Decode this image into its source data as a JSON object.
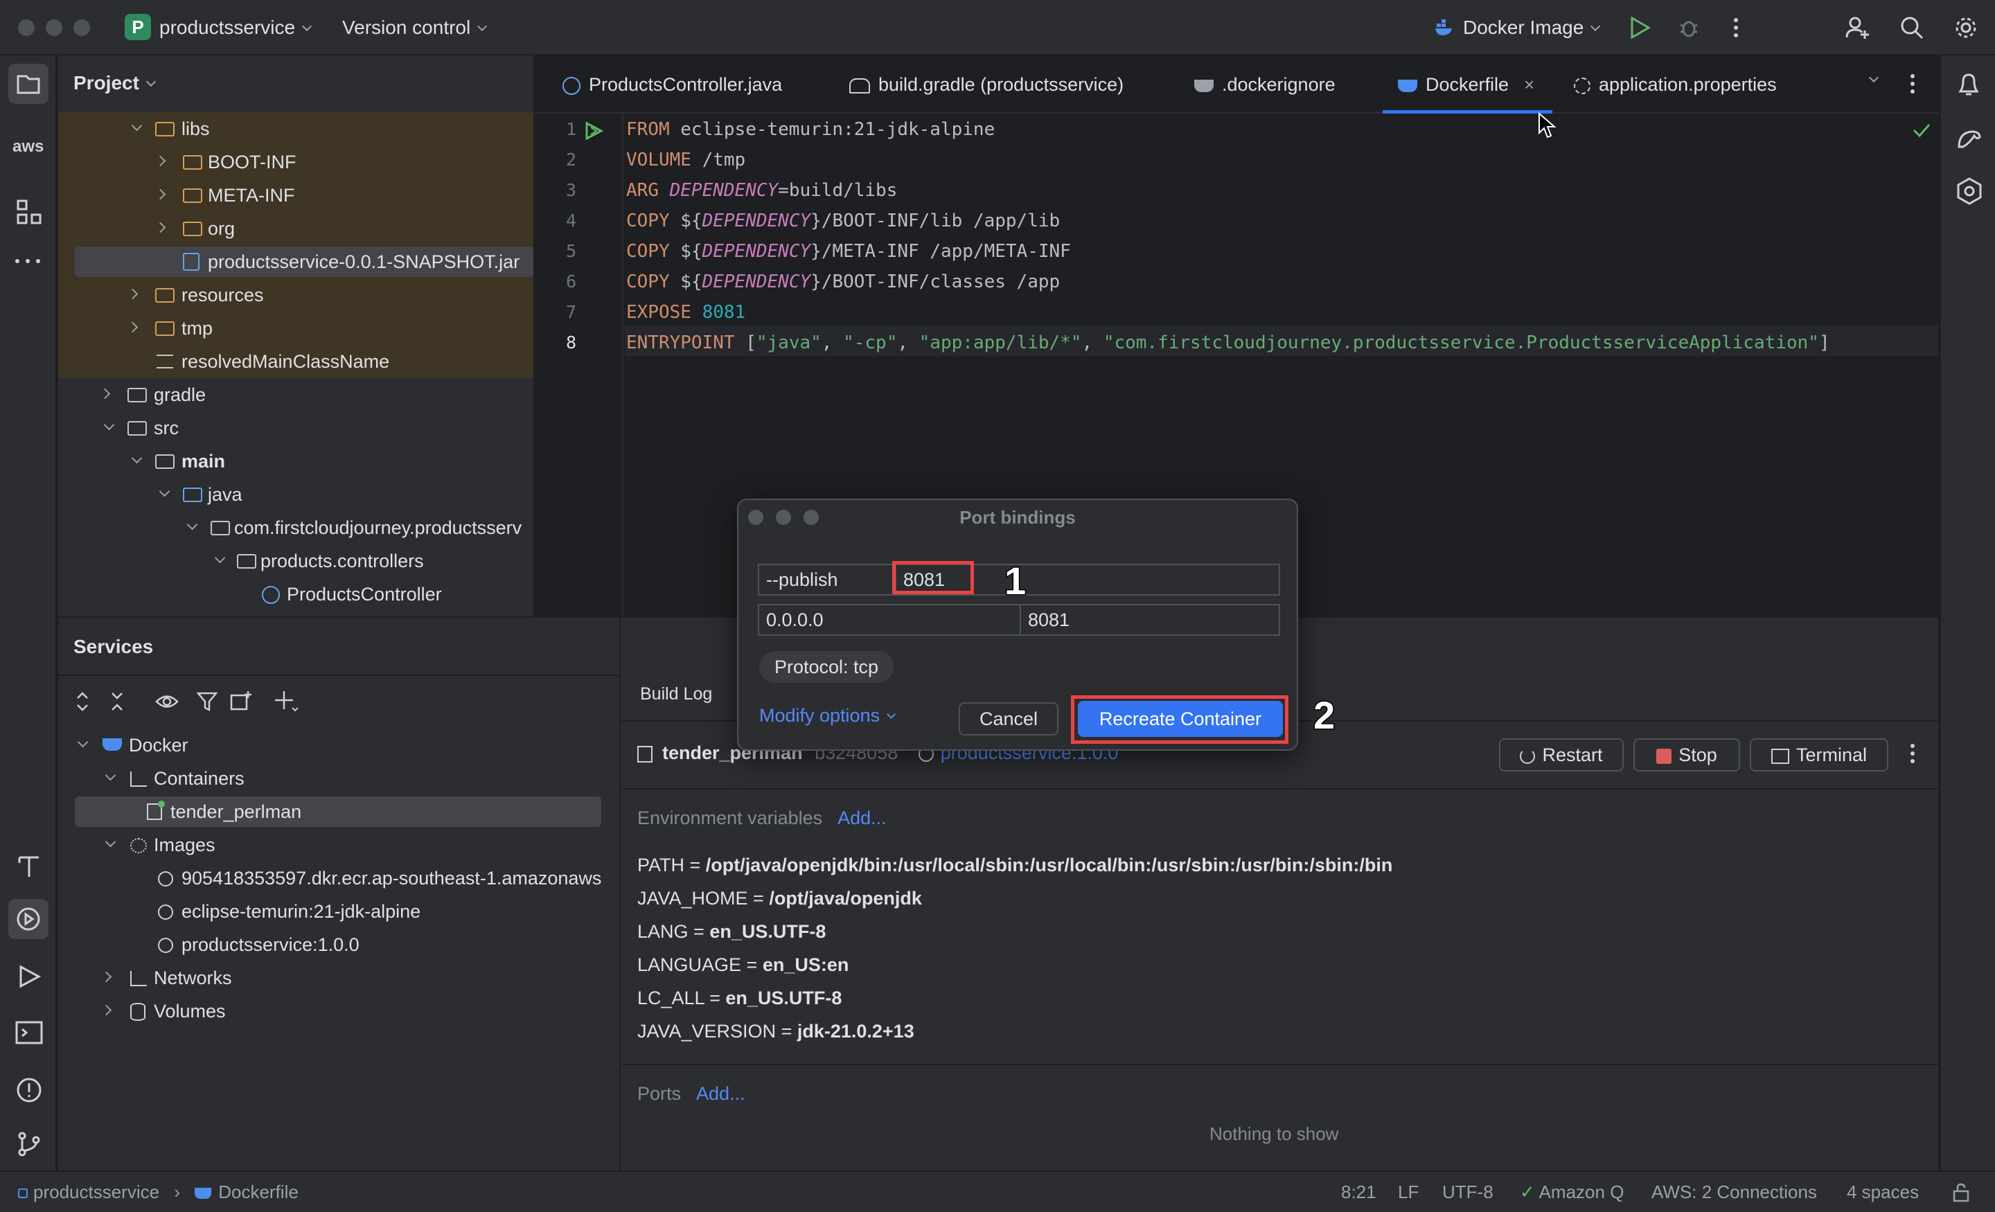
{
  "titlebar": {
    "project_badge": "P",
    "project_name": "productsservice",
    "version_control": "Version control",
    "run_config": "Docker Image"
  },
  "project_panel": {
    "title": "Project",
    "tree": [
      {
        "label": "libs",
        "icon": "folder-icon"
      },
      {
        "label": "BOOT-INF",
        "icon": "folder-icon"
      },
      {
        "label": "META-INF",
        "icon": "folder-icon"
      },
      {
        "label": "org",
        "icon": "folder-icon"
      },
      {
        "label": "productsservice-0.0.1-SNAPSHOT.jar",
        "icon": "jar-icon"
      },
      {
        "label": "resources",
        "icon": "folder-icon"
      },
      {
        "label": "tmp",
        "icon": "folder-icon"
      },
      {
        "label": "resolvedMainClassName",
        "icon": "text-file-icon"
      },
      {
        "label": "gradle",
        "icon": "folder-icon"
      },
      {
        "label": "src",
        "icon": "folder-icon"
      },
      {
        "label": "main",
        "icon": "folder-icon"
      },
      {
        "label": "java",
        "icon": "folder-icon"
      },
      {
        "label": "com.firstcloudjourney.productsserv",
        "icon": "package-icon"
      },
      {
        "label": "products.controllers",
        "icon": "package-icon"
      },
      {
        "label": "ProductsController",
        "icon": "class-icon"
      }
    ]
  },
  "editor": {
    "tabs": [
      {
        "label": "ProductsController.java"
      },
      {
        "label": "build.gradle (productsservice)"
      },
      {
        "label": ".dockerignore"
      },
      {
        "label": "Dockerfile",
        "active": true
      },
      {
        "label": "application.properties"
      }
    ],
    "line_numbers": [
      "1",
      "2",
      "3",
      "4",
      "5",
      "6",
      "7",
      "8"
    ],
    "lines": {
      "l1_kw": "FROM",
      "l1_rest": " eclipse-temurin:21-jdk-alpine",
      "l2_kw": "VOLUME",
      "l2_rest": " /tmp",
      "l3_kw": "ARG",
      "l3_var": "DEPENDENCY",
      "l3_rest": "=build/libs",
      "l4_kw": "COPY",
      "l4_a": " ${",
      "l4_var": "DEPENDENCY",
      "l4_b": "}/BOOT-INF/lib /app/lib",
      "l5_kw": "COPY",
      "l5_a": " ${",
      "l5_var": "DEPENDENCY",
      "l5_b": "}/META-INF /app/META-INF",
      "l6_kw": "COPY",
      "l6_a": " ${",
      "l6_var": "DEPENDENCY",
      "l6_b": "}/BOOT-INF/classes /app",
      "l7_kw": "EXPOSE",
      "l7_num": "8081",
      "l8_kw": "ENTRYPOINT",
      "l8_a": " [",
      "l8_s1": "\"java\"",
      "l8_c1": ", ",
      "l8_s2": "\"-cp\"",
      "l8_c2": ", ",
      "l8_s3": "\"app:app/lib/*\"",
      "l8_c3": ", ",
      "l8_s4": "\"com.firstcloudjourney.productsservice.ProductsserviceApplication\"",
      "l8_b": "]"
    }
  },
  "services": {
    "title": "Services",
    "tree": {
      "docker": "Docker",
      "containers": "Containers",
      "container1": "tender_perlman",
      "images": "Images",
      "image1": "905418353597.dkr.ecr.ap-southeast-1.amazonaws",
      "image2": "eclipse-temurin:21-jdk-alpine",
      "image3": "productsservice:1.0.0",
      "networks": "Networks",
      "volumes": "Volumes"
    },
    "detail": {
      "tab": "Build Log",
      "container_name": "tender_perlman",
      "container_id": "b3248058",
      "image_link": "productsservice:1.0.0",
      "restart": "Restart",
      "stop": "Stop",
      "terminal": "Terminal",
      "env_label": "Environment variables",
      "add": "Add...",
      "env": [
        {
          "k": "PATH",
          "v": "/opt/java/openjdk/bin:/usr/local/sbin:/usr/local/bin:/usr/sbin:/usr/bin:/sbin:/bin"
        },
        {
          "k": "JAVA_HOME",
          "v": "/opt/java/openjdk"
        },
        {
          "k": "LANG",
          "v": "en_US.UTF-8"
        },
        {
          "k": "LANGUAGE",
          "v": "en_US:en"
        },
        {
          "k": "LC_ALL",
          "v": "en_US.UTF-8"
        },
        {
          "k": "JAVA_VERSION",
          "v": "jdk-21.0.2+13"
        }
      ],
      "eq": " = ",
      "ports_label": "Ports",
      "ports_add": "Add...",
      "nothing": "Nothing to show"
    }
  },
  "dialog": {
    "title": "Port bindings",
    "publish_label": "--publish",
    "publish_value": "8081",
    "host_ip": "0.0.0.0",
    "host_port": "8081",
    "protocol": "Protocol: tcp",
    "modify_options": "Modify options",
    "cancel": "Cancel",
    "recreate": "Recreate Container",
    "annotation1": "1",
    "annotation2": "2"
  },
  "statusbar": {
    "breadcrumb1": "productsservice",
    "breadcrumb2": "Dockerfile",
    "position": "8:21",
    "line_sep": "LF",
    "encoding": "UTF-8",
    "amazonq": "Amazon Q",
    "aws": "AWS: 2 Connections",
    "indent": "4 spaces"
  },
  "colors": {
    "accent": "#3574f0",
    "annotation_box": "#e84444",
    "highlight_tree": "#3f3524"
  }
}
